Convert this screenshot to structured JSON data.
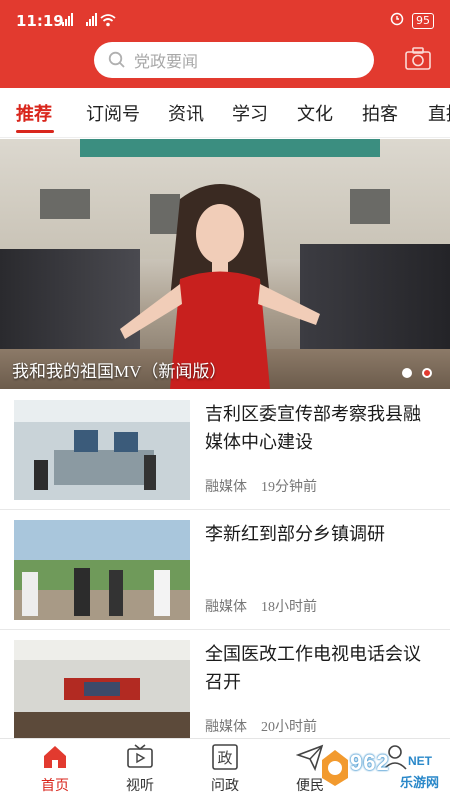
{
  "status_bar": {
    "time": "11:19",
    "signal_text": "5G 5G",
    "battery": "95"
  },
  "search": {
    "placeholder": "党政要闻",
    "icon": "search-icon"
  },
  "camera": {
    "icon": "camera-icon"
  },
  "tabs": [
    {
      "label": "推荐",
      "active": true
    },
    {
      "label": "订阅号",
      "active": false
    },
    {
      "label": "资讯",
      "active": false
    },
    {
      "label": "学习",
      "active": false
    },
    {
      "label": "文化",
      "active": false
    },
    {
      "label": "拍客",
      "active": false
    },
    {
      "label": "直播",
      "active": false
    }
  ],
  "banner": {
    "caption": "我和我的祖国MV（新闻版）",
    "slides": 2,
    "active_slide": 2
  },
  "news": [
    {
      "title": "吉利区委宣传部考察我县融媒体中心建设",
      "source": "融媒体",
      "time": "19分钟前"
    },
    {
      "title": "李新红到部分乡镇调研",
      "source": "融媒体",
      "time": "18小时前"
    },
    {
      "title": "全国医改工作电视电话会议召开",
      "source": "融媒体",
      "time": "20小时前"
    }
  ],
  "bottom_nav": [
    {
      "label": "首页",
      "icon": "home-icon",
      "active": true
    },
    {
      "label": "视听",
      "icon": "tv-icon",
      "active": false
    },
    {
      "label": "问政",
      "icon": "politics-icon",
      "active": false
    },
    {
      "label": "便民",
      "icon": "send-icon",
      "active": false
    }
  ],
  "watermark": {
    "num": "962",
    "net": "NET",
    "cn": "乐游网"
  },
  "colors": {
    "brand_red": "#e23a2f",
    "active_red": "#d9261c"
  }
}
